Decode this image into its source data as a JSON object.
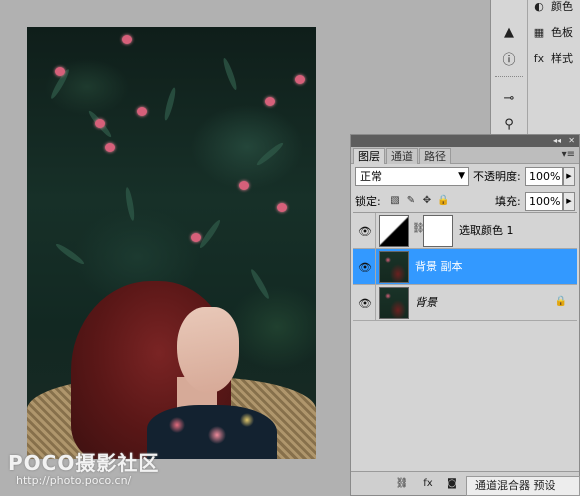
{
  "dock": {
    "items": [
      {
        "icon": "palette-icon",
        "label": "颜色"
      },
      {
        "icon": "swatches-icon",
        "label": "色板"
      },
      {
        "icon": "styles-icon",
        "label": "样式"
      }
    ],
    "tools": [
      {
        "icon": "navigator-icon"
      },
      {
        "icon": "info-icon"
      },
      {
        "icon": "brush-preset-icon"
      },
      {
        "icon": "tool-preset-icon"
      }
    ]
  },
  "layers_panel": {
    "title_controls": {
      "collapse": "◂◂",
      "close": "✕"
    },
    "tabs": [
      {
        "label": "图层",
        "active": true
      },
      {
        "label": "通道",
        "active": false
      },
      {
        "label": "路径",
        "active": false
      }
    ],
    "menu_glyph": "▾≡",
    "blend_mode": "正常",
    "opacity_label": "不透明度:",
    "opacity_value": "100%",
    "lock_label": "锁定:",
    "fill_label": "填充:",
    "fill_value": "100%",
    "layers": [
      {
        "name": "选取颜色 1",
        "type": "adjustment",
        "selected": false,
        "italic": false,
        "locked": false
      },
      {
        "name": "背景 副本",
        "type": "image",
        "selected": true,
        "italic": false,
        "locked": false
      },
      {
        "name": "背景",
        "type": "image",
        "selected": false,
        "italic": true,
        "locked": true
      }
    ],
    "footer_icons": [
      "link-icon",
      "fx-icon",
      "mask-icon",
      "adjustment-icon",
      "group-icon",
      "new-layer-icon",
      "trash-icon"
    ]
  },
  "bottom_strip": {
    "text": "通道混合器 预设"
  },
  "watermark": {
    "logo": "POCO摄影社区",
    "url": "http://photo.poco.cn/"
  }
}
